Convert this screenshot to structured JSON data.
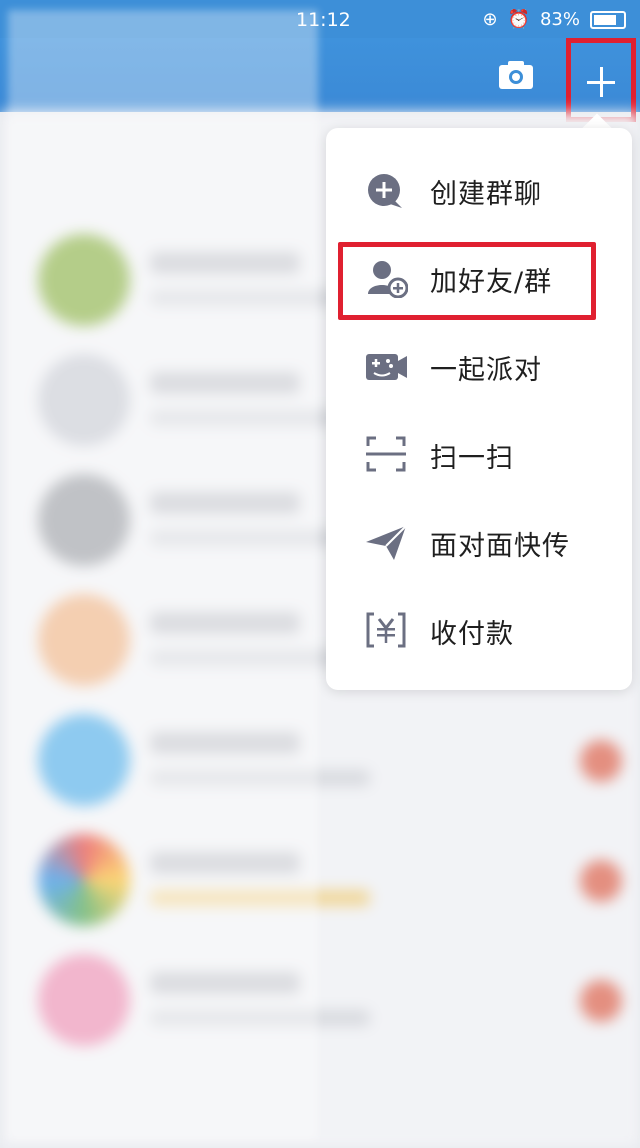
{
  "status_bar": {
    "time": "11:12",
    "battery": "83%"
  },
  "menu": {
    "items": [
      {
        "label": "创建群聊",
        "icon": "create-group-chat-icon"
      },
      {
        "label": "加好友/群",
        "icon": "add-friend-icon"
      },
      {
        "label": "一起派对",
        "icon": "party-game-icon"
      },
      {
        "label": "扫一扫",
        "icon": "scan-icon"
      },
      {
        "label": "面对面快传",
        "icon": "face-to-face-transfer-icon"
      },
      {
        "label": "收付款",
        "icon": "payment-icon"
      }
    ]
  },
  "colors": {
    "accent": "#3d8fd8",
    "highlight": "#e02030",
    "icon": "#6b6f82"
  }
}
